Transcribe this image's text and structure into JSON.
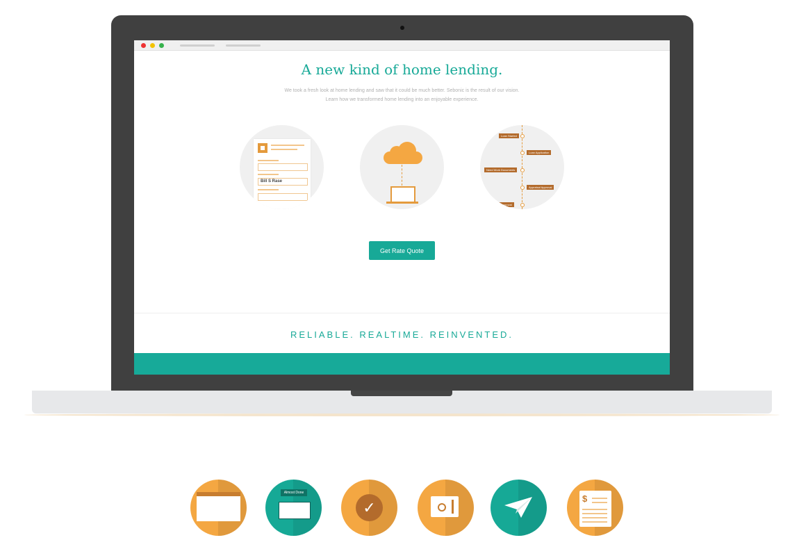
{
  "hero": {
    "headline": "A new kind of home lending.",
    "subtext_line1": "We took a fresh look at home lending and saw that it could be much better. Sebonic is the result of our vision.",
    "subtext_line2": "Learn how we transformed home lending into an enjoyable experience."
  },
  "form_illustration": {
    "field_value": "Bill S Rase"
  },
  "timeline": {
    "labels": [
      "Loan Started",
      "Loan Application",
      "Need Work Documents",
      "Appraisal Approval",
      "Approval"
    ]
  },
  "cta": {
    "label": "Get Rate Quote"
  },
  "tagline": "RELIABLE.  REALTIME.  REINVENTED.",
  "feature_icons": {
    "status_label": "Almost Done",
    "document_symbol": "$",
    "check_symbol": "✓"
  },
  "colors": {
    "accent_teal": "#17a997",
    "accent_orange": "#f4a742",
    "laptop_frame": "#404040"
  }
}
